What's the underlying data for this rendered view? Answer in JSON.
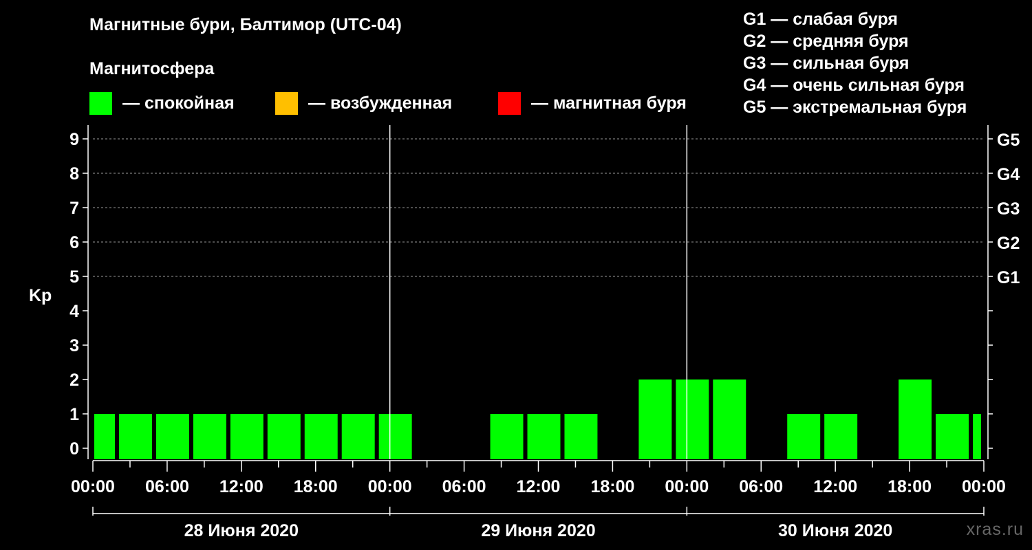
{
  "title": "Магнитные бури, Балтимор (UTC-04)",
  "subtitle": "Магнитосфера",
  "legend": [
    {
      "color": "#00ff00",
      "label": "— спокойная"
    },
    {
      "color": "#ffbf00",
      "label": "— возбужденная"
    },
    {
      "color": "#ff0000",
      "label": "— магнитная буря"
    }
  ],
  "g_scale": [
    "G1 — слабая буря",
    "G2 — средняя буря",
    "G3 — сильная буря",
    "G4 — очень сильная буря",
    "G5 — экстремальная буря"
  ],
  "watermark": "xras.ru",
  "chart_data": {
    "type": "bar",
    "ylabel": "Kp",
    "ylim": [
      0,
      9
    ],
    "y_ticks": [
      "0",
      "1",
      "2",
      "3",
      "4",
      "5",
      "6",
      "7",
      "8",
      "9"
    ],
    "right_ticks": [
      {
        "kp": 5,
        "label": "G1"
      },
      {
        "kp": 6,
        "label": "G2"
      },
      {
        "kp": 7,
        "label": "G3"
      },
      {
        "kp": 8,
        "label": "G4"
      },
      {
        "kp": 9,
        "label": "G5"
      }
    ],
    "x_tick_labels": [
      "00:00",
      "06:00",
      "12:00",
      "18:00",
      "00:00",
      "06:00",
      "12:00",
      "18:00",
      "00:00",
      "06:00",
      "12:00",
      "18:00",
      "00:00"
    ],
    "dates": [
      "28 Июня 2020",
      "29 Июня 2020",
      "30 Июня 2020"
    ],
    "grid": "dashed horizontal at Kp 5–9",
    "bar_color": "#00ff00",
    "bars": [
      {
        "start": "28.06 00:00",
        "end": "28.06 02:00",
        "kp": 1
      },
      {
        "start": "28.06 02:00",
        "end": "28.06 05:00",
        "kp": 1
      },
      {
        "start": "28.06 05:00",
        "end": "28.06 08:00",
        "kp": 1
      },
      {
        "start": "28.06 08:00",
        "end": "28.06 11:00",
        "kp": 1
      },
      {
        "start": "28.06 11:00",
        "end": "28.06 14:00",
        "kp": 1
      },
      {
        "start": "28.06 14:00",
        "end": "28.06 17:00",
        "kp": 1
      },
      {
        "start": "28.06 17:00",
        "end": "28.06 20:00",
        "kp": 1
      },
      {
        "start": "28.06 20:00",
        "end": "28.06 23:00",
        "kp": 1
      },
      {
        "start": "28.06 23:00",
        "end": "29.06 02:00",
        "kp": 1
      },
      {
        "start": "29.06 02:00",
        "end": "29.06 05:00",
        "kp": 0
      },
      {
        "start": "29.06 05:00",
        "end": "29.06 08:00",
        "kp": 0
      },
      {
        "start": "29.06 08:00",
        "end": "29.06 11:00",
        "kp": 1
      },
      {
        "start": "29.06 11:00",
        "end": "29.06 14:00",
        "kp": 1
      },
      {
        "start": "29.06 14:00",
        "end": "29.06 17:00",
        "kp": 1
      },
      {
        "start": "29.06 17:00",
        "end": "29.06 20:00",
        "kp": 0
      },
      {
        "start": "29.06 20:00",
        "end": "29.06 23:00",
        "kp": 2
      },
      {
        "start": "29.06 23:00",
        "end": "30.06 02:00",
        "kp": 2
      },
      {
        "start": "30.06 02:00",
        "end": "30.06 05:00",
        "kp": 2
      },
      {
        "start": "30.06 05:00",
        "end": "30.06 08:00",
        "kp": 0
      },
      {
        "start": "30.06 08:00",
        "end": "30.06 11:00",
        "kp": 1
      },
      {
        "start": "30.06 11:00",
        "end": "30.06 14:00",
        "kp": 1
      },
      {
        "start": "30.06 14:00",
        "end": "30.06 17:00",
        "kp": 0
      },
      {
        "start": "30.06 17:00",
        "end": "30.06 20:00",
        "kp": 2
      },
      {
        "start": "30.06 20:00",
        "end": "30.06 23:00",
        "kp": 1
      },
      {
        "start": "30.06 23:00",
        "end": "01.07 00:00",
        "kp": 1
      }
    ]
  }
}
